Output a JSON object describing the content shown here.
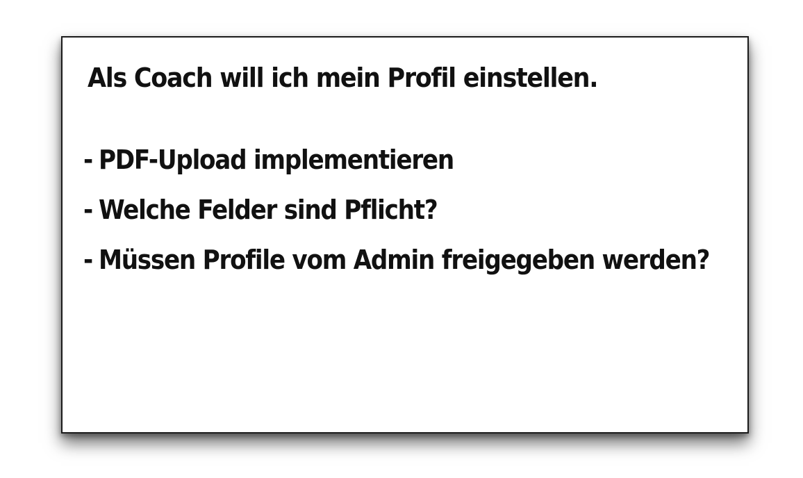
{
  "card": {
    "title": "Als Coach will ich mein Profil einstellen.",
    "items": [
      {
        "bullet": "-",
        "text": "PDF-Upload implementieren"
      },
      {
        "bullet": "-",
        "text": "Welche Felder sind Pflicht?"
      },
      {
        "bullet": "-",
        "text": "Müssen Profile vom Admin freigegeben werden?"
      }
    ]
  }
}
